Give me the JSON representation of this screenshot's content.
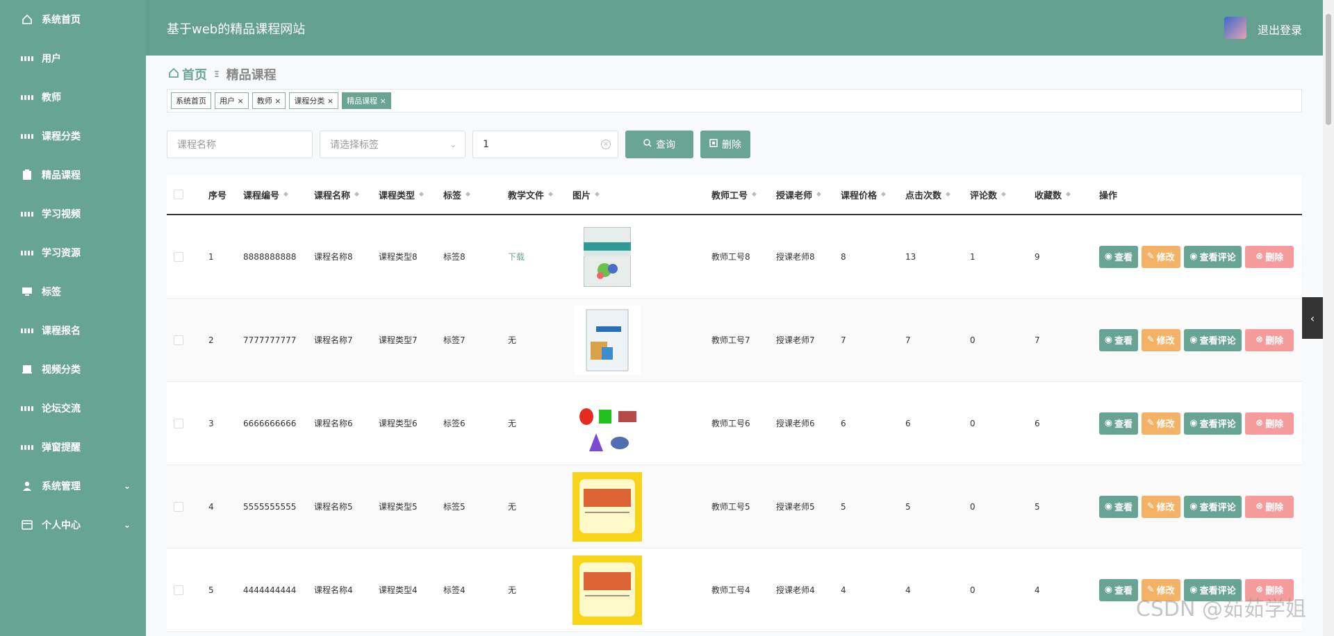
{
  "sidebar": {
    "items": [
      {
        "label": "系统首页",
        "icon": "home-icon"
      },
      {
        "label": "用户",
        "icon": "grid-icon"
      },
      {
        "label": "教师",
        "icon": "grid-icon"
      },
      {
        "label": "课程分类",
        "icon": "grid-icon"
      },
      {
        "label": "精品课程",
        "icon": "clipboard-icon"
      },
      {
        "label": "学习视频",
        "icon": "grid-icon"
      },
      {
        "label": "学习资源",
        "icon": "grid-icon"
      },
      {
        "label": "标签",
        "icon": "monitor-icon"
      },
      {
        "label": "课程报名",
        "icon": "grid-icon"
      },
      {
        "label": "视频分类",
        "icon": "tablet-icon"
      },
      {
        "label": "论坛交流",
        "icon": "grid-icon"
      },
      {
        "label": "弹窗提醒",
        "icon": "grid-icon"
      },
      {
        "label": "系统管理",
        "icon": "user-icon"
      },
      {
        "label": "个人中心",
        "icon": "card-icon"
      }
    ]
  },
  "header": {
    "title": "基于web的精品课程网站",
    "logout": "退出登录"
  },
  "breadcrumb": {
    "home": "首页",
    "current": "精品课程"
  },
  "tags": [
    {
      "label": "系统首页"
    },
    {
      "label": "用户 ×"
    },
    {
      "label": "教师 ×"
    },
    {
      "label": "课程分类 ×"
    },
    {
      "label": "精品课程 ×"
    }
  ],
  "search": {
    "name_placeholder": "课程名称",
    "tag_placeholder": "请选择标签",
    "third_value": "1",
    "query_label": "查询",
    "delete_label": "删除"
  },
  "table": {
    "headers": {
      "index": "序号",
      "code": "课程编号",
      "name": "课程名称",
      "type": "课程类型",
      "tag": "标签",
      "file": "教学文件",
      "image": "图片",
      "teacher_id": "教师工号",
      "teacher": "授课老师",
      "price": "课程价格",
      "clicks": "点击次数",
      "comments": "评论数",
      "favorites": "收藏数",
      "ops": "操作"
    },
    "rows": [
      {
        "index": "1",
        "code": "8888888888",
        "name": "课程名称8",
        "type": "课程类型8",
        "tag": "标签8",
        "file": "下载",
        "teacher_id": "教师工号8",
        "teacher": "授课老师8",
        "price": "8",
        "clicks": "13",
        "comments": "1",
        "favorites": "9"
      },
      {
        "index": "2",
        "code": "7777777777",
        "name": "课程名称7",
        "type": "课程类型7",
        "tag": "标签7",
        "file": "无",
        "teacher_id": "教师工号7",
        "teacher": "授课老师7",
        "price": "7",
        "clicks": "7",
        "comments": "0",
        "favorites": "7"
      },
      {
        "index": "3",
        "code": "6666666666",
        "name": "课程名称6",
        "type": "课程类型6",
        "tag": "标签6",
        "file": "无",
        "teacher_id": "教师工号6",
        "teacher": "授课老师6",
        "price": "6",
        "clicks": "6",
        "comments": "0",
        "favorites": "6"
      },
      {
        "index": "4",
        "code": "5555555555",
        "name": "课程名称5",
        "type": "课程类型5",
        "tag": "标签5",
        "file": "无",
        "teacher_id": "教师工号5",
        "teacher": "授课老师5",
        "price": "5",
        "clicks": "5",
        "comments": "0",
        "favorites": "5"
      },
      {
        "index": "5",
        "code": "4444444444",
        "name": "课程名称4",
        "type": "课程类型4",
        "tag": "标签4",
        "file": "无",
        "teacher_id": "教师工号4",
        "teacher": "授课老师4",
        "price": "4",
        "clicks": "4",
        "comments": "0",
        "favorites": "4"
      }
    ],
    "op_labels": {
      "view": "查看",
      "edit": "修改",
      "comments": "查看评论",
      "delete": "删除"
    }
  },
  "watermark": "CSDN @茹茹学姐",
  "colors": {
    "primary": "#67a493",
    "edit": "#f3b265",
    "delete": "#f59b9b"
  }
}
